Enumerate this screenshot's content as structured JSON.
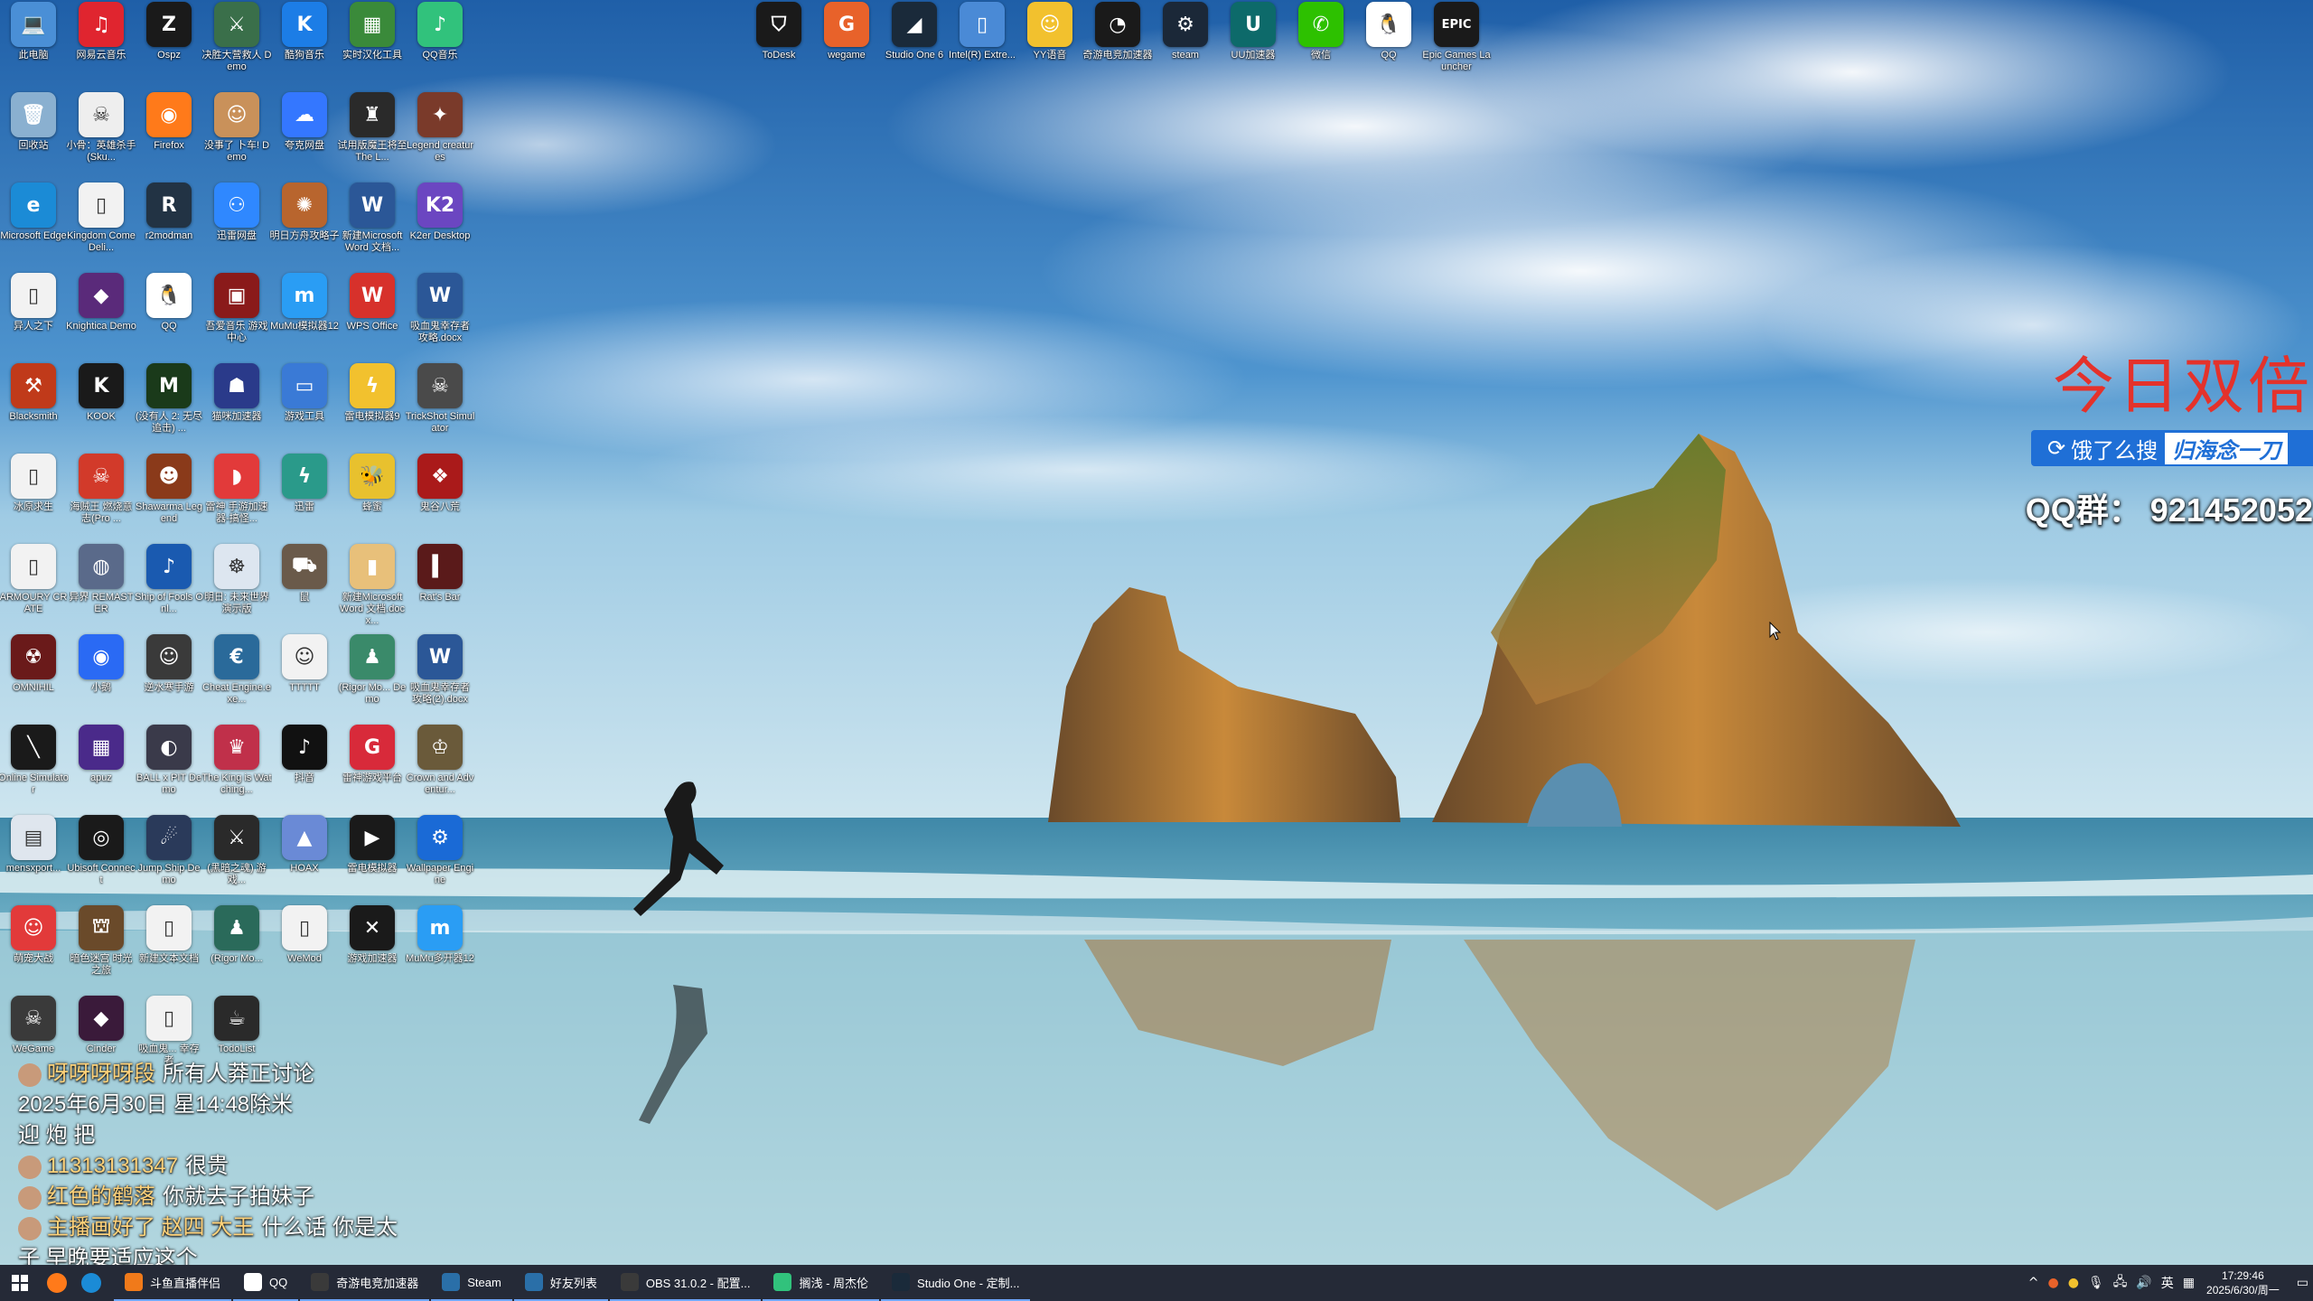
{
  "desktop": {
    "icons": [
      {
        "label": "此电脑",
        "color": "#4a8fd6",
        "glyph": "💻"
      },
      {
        "label": "网易云音乐",
        "color": "#e0252f",
        "glyph": "♫"
      },
      {
        "label": "Ospz",
        "color": "#1a1a1a",
        "glyph": "Z"
      },
      {
        "label": "决胜大营救人 Demo",
        "color": "#3a6f4a",
        "glyph": "⚔"
      },
      {
        "label": "酷狗音乐",
        "color": "#1c7de6",
        "glyph": "K"
      },
      {
        "label": "实时汉化工具",
        "color": "#3a8a3a",
        "glyph": "▦"
      },
      {
        "label": "QQ音乐",
        "color": "#31c27c",
        "glyph": "♪"
      },
      {
        "label": "回收站",
        "color": "#8ab0d0",
        "glyph": "🗑"
      },
      {
        "label": "小骨：英雄杀手(Sku...",
        "color": "#eeeeee",
        "glyph": "☠"
      },
      {
        "label": "Firefox",
        "color": "#ff7a1a",
        "glyph": "◉"
      },
      {
        "label": "没事了 卜车! Demo",
        "color": "#c9915a",
        "glyph": "☺"
      },
      {
        "label": "夸克网盘",
        "color": "#3477ff",
        "glyph": "☁"
      },
      {
        "label": "试用版魔王将至 The L...",
        "color": "#2a2a2a",
        "glyph": "♜"
      },
      {
        "label": "Legend creatures",
        "color": "#7a3a2a",
        "glyph": "✦"
      },
      {
        "label": "Microsoft Edge",
        "color": "#1b8bd6",
        "glyph": "e"
      },
      {
        "label": "Kingdom Come Deli...",
        "color": "#f2f2f2",
        "glyph": "▯"
      },
      {
        "label": "r2modman",
        "color": "#223344",
        "glyph": "R"
      },
      {
        "label": "迅雷网盘",
        "color": "#2f88ff",
        "glyph": "⚇"
      },
      {
        "label": "明日方舟攻略子",
        "color": "#b8652e",
        "glyph": "✺"
      },
      {
        "label": "新建Microsoft Word 文档...",
        "color": "#2b5797",
        "glyph": "W"
      },
      {
        "label": "K2er Desktop",
        "color": "#6b46c1",
        "glyph": "K2"
      },
      {
        "label": "异人之下",
        "color": "#f2f2f2",
        "glyph": "▯"
      },
      {
        "label": "Knightica Demo",
        "color": "#5a2a7a",
        "glyph": "◆"
      },
      {
        "label": "QQ",
        "color": "#ffffff",
        "glyph": "🐧"
      },
      {
        "label": "吾爱音乐 游戏中心",
        "color": "#8a1a1a",
        "glyph": "▣"
      },
      {
        "label": "MuMu模拟器12",
        "color": "#2a9df4",
        "glyph": "m"
      },
      {
        "label": "WPS Office",
        "color": "#d7312b",
        "glyph": "W"
      },
      {
        "label": "吸血鬼幸存者 攻略.docx",
        "color": "#2b5797",
        "glyph": "W"
      },
      {
        "label": "Blacksmith",
        "color": "#c03a1a",
        "glyph": "⚒"
      },
      {
        "label": "KOOK",
        "color": "#1a1a1a",
        "glyph": "K"
      },
      {
        "label": "(没有人 2: 无尽追击) ...",
        "color": "#1a3a1a",
        "glyph": "M"
      },
      {
        "label": "猫咪加速器",
        "color": "#2a3a8a",
        "glyph": "☗"
      },
      {
        "label": "游戏工具",
        "color": "#3a7ad6",
        "glyph": "▭"
      },
      {
        "label": "雷电模拟器9",
        "color": "#f2c12e",
        "glyph": "ϟ"
      },
      {
        "label": "TrickShot Simulator",
        "color": "#4a4a4a",
        "glyph": "☠"
      },
      {
        "label": "冰原求生",
        "color": "#f2f2f2",
        "glyph": "▯"
      },
      {
        "label": "海贼王 燃烧意志(Pro ...",
        "color": "#d23a2a",
        "glyph": "☠"
      },
      {
        "label": "Shawarma Legend",
        "color": "#8a3a1a",
        "glyph": "☻"
      },
      {
        "label": "雷神 手游加速器-搞怪...",
        "color": "#e23a3a",
        "glyph": "◗"
      },
      {
        "label": "迅雷",
        "color": "#2a9a8a",
        "glyph": "ϟ"
      },
      {
        "label": "蜂蜜",
        "color": "#e8c12e",
        "glyph": "🐝"
      },
      {
        "label": "鬼谷八荒",
        "color": "#aa1a1a",
        "glyph": "❖"
      },
      {
        "label": "ARMOURY CRATE",
        "color": "#f2f2f2",
        "glyph": "▯"
      },
      {
        "label": "异界 REMASTER",
        "color": "#5a6a8a",
        "glyph": "◍"
      },
      {
        "label": "Ship of Fools Onl...",
        "color": "#1a5ab0",
        "glyph": "♪"
      },
      {
        "label": "明日: 未来世界 演示版",
        "color": "#dde6f0",
        "glyph": "☸"
      },
      {
        "label": "鼠",
        "color": "#6a5a4a",
        "glyph": "⛟"
      },
      {
        "label": "新建Microsoft Word 文档.docx...",
        "color": "#e8c07a",
        "glyph": "▮"
      },
      {
        "label": "Rat's Bar",
        "color": "#5a1a1a",
        "glyph": "▍"
      },
      {
        "label": "OMNIHIL",
        "color": "#6a1a1a",
        "glyph": "☢"
      },
      {
        "label": "小鹅",
        "color": "#2a6af4",
        "glyph": "◉"
      },
      {
        "label": "逆水寒手游",
        "color": "#3a3a3a",
        "glyph": "☺"
      },
      {
        "label": "Cheat Engine.exe...",
        "color": "#2a6a9a",
        "glyph": "€"
      },
      {
        "label": "TTTTT",
        "color": "#f2f2f2",
        "glyph": "☺"
      },
      {
        "label": "(Rigor Mo... Demo",
        "color": "#3a8a6a",
        "glyph": "♟"
      },
      {
        "label": "吸血鬼幸存者 攻略(2).docx",
        "color": "#2b5797",
        "glyph": "W"
      },
      {
        "label": "Online Simulator",
        "color": "#1a1a1a",
        "glyph": "╲"
      },
      {
        "label": "apuz",
        "color": "#4a2a8a",
        "glyph": "▦"
      },
      {
        "label": "BALL x PIT Demo",
        "color": "#3a3a4a",
        "glyph": "◐"
      },
      {
        "label": "The King is Watching...",
        "color": "#c0304a",
        "glyph": "♛"
      },
      {
        "label": "抖音",
        "color": "#111111",
        "glyph": "♪"
      },
      {
        "label": "雷神游戏平台",
        "color": "#d82a3a",
        "glyph": "G"
      },
      {
        "label": "Crown and Adventur...",
        "color": "#6a5a3a",
        "glyph": "♔"
      },
      {
        "label": "mensxport...",
        "color": "#dfe6ee",
        "glyph": "▤"
      },
      {
        "label": "Ubisoft Connect",
        "color": "#1a1a1a",
        "glyph": "◎"
      },
      {
        "label": "Jump Ship Demo",
        "color": "#2a3a5a",
        "glyph": "☄"
      },
      {
        "label": "(黑暗之魂) 游戏...",
        "color": "#2a2a2a",
        "glyph": "⚔"
      },
      {
        "label": "HOAX",
        "color": "#6a8ad6",
        "glyph": "▲"
      },
      {
        "label": "雷电模拟器",
        "color": "#1a1a1a",
        "glyph": "▶"
      },
      {
        "label": "Wallpaper Engine",
        "color": "#1a6ad6",
        "glyph": "⚙"
      },
      {
        "label": "萌宠大战",
        "color": "#e23a3a",
        "glyph": "☺"
      },
      {
        "label": "暗色迷宫 时光之旅",
        "color": "#6a4a2a",
        "glyph": "⛫"
      },
      {
        "label": "新建文本文档",
        "color": "#f2f2f2",
        "glyph": "▯"
      },
      {
        "label": "(Rigor Mo...",
        "color": "#2a6a5a",
        "glyph": "♟"
      },
      {
        "label": "WeMod",
        "color": "#f2f2f2",
        "glyph": "▯"
      },
      {
        "label": "游戏加速器",
        "color": "#1a1a1a",
        "glyph": "✕"
      },
      {
        "label": "MuMu多开器12",
        "color": "#2a9df4",
        "glyph": "m"
      },
      {
        "label": "WeGame",
        "color": "#3a3a3a",
        "glyph": "☠"
      },
      {
        "label": "Cinder",
        "color": "#3a1a3a",
        "glyph": "◆"
      },
      {
        "label": "吸血鬼... 幸存者",
        "color": "#f2f2f2",
        "glyph": "▯"
      },
      {
        "label": "TodoList",
        "color": "#2a2a2a",
        "glyph": "☕"
      }
    ],
    "top_icons": [
      {
        "label": "ToDesk",
        "color": "#1a1a1a",
        "glyph": "⛉"
      },
      {
        "label": "wegame",
        "color": "#e8622a",
        "glyph": "G"
      },
      {
        "label": "Studio One 6",
        "color": "#1a2a3a",
        "glyph": "◢"
      },
      {
        "label": "Intel(R) Extre...",
        "color": "#4a8ad6",
        "glyph": "▯"
      },
      {
        "label": "YY语音",
        "color": "#f2c12e",
        "glyph": "☺"
      },
      {
        "label": "奇游电竞加速器",
        "color": "#1a1a1a",
        "glyph": "◔"
      },
      {
        "label": "steam",
        "color": "#1b2838",
        "glyph": "⚙"
      },
      {
        "label": "UU加速器",
        "color": "#0d6a6a",
        "glyph": "U"
      },
      {
        "label": "微信",
        "color": "#2dc100",
        "glyph": "✆"
      },
      {
        "label": "QQ",
        "color": "#ffffff",
        "glyph": "🐧"
      },
      {
        "label": "Epic Games Launcher",
        "color": "#1a1a1a",
        "glyph": "EPIC"
      }
    ]
  },
  "promo": {
    "title": "今日双倍",
    "search_prefix": "饿了么搜",
    "search_keyword": "归海念一刀",
    "qq_group": "QQ群： 921452052"
  },
  "danmaku": [
    {
      "user": "呀呀呀呀段",
      "text": "所有人莽正讨论"
    },
    {
      "user": "",
      "text": "2025年6月30日 星14:48除米"
    },
    {
      "user": "",
      "text": "迎 炮 把"
    },
    {
      "user": "11313131347",
      "text": "很贵"
    },
    {
      "user": "红色的鹤落",
      "text": "你就去子拍妹子"
    },
    {
      "user": "主播画好了 赵四 大王",
      "text": "什么话 你是太"
    },
    {
      "user": "",
      "text": "子 早晚要适应这个"
    }
  ],
  "taskbar": {
    "pinned": [
      {
        "name": "firefox",
        "color": "#ff7a1a"
      },
      {
        "name": "edge",
        "color": "#1b8bd6"
      }
    ],
    "apps": [
      {
        "label": "斗鱼直播伴侣",
        "color": "#f07a1a"
      },
      {
        "label": "QQ",
        "color": "#ffffff"
      },
      {
        "label": "奇游电竞加速器",
        "color": "#3a3a3a"
      },
      {
        "label": "Steam",
        "color": "#2a6fa8"
      },
      {
        "label": "好友列表",
        "color": "#2a6fa8"
      },
      {
        "label": "OBS 31.0.2 - 配置...",
        "color": "#3a3a3a"
      },
      {
        "label": "搁浅 - 周杰伦",
        "color": "#31c27c"
      },
      {
        "label": "Studio One - 定制...",
        "color": "#1a2a3a"
      }
    ],
    "tray": {
      "ime": "英",
      "time": "17:29:46",
      "date": "2025/6/30/周一"
    }
  }
}
